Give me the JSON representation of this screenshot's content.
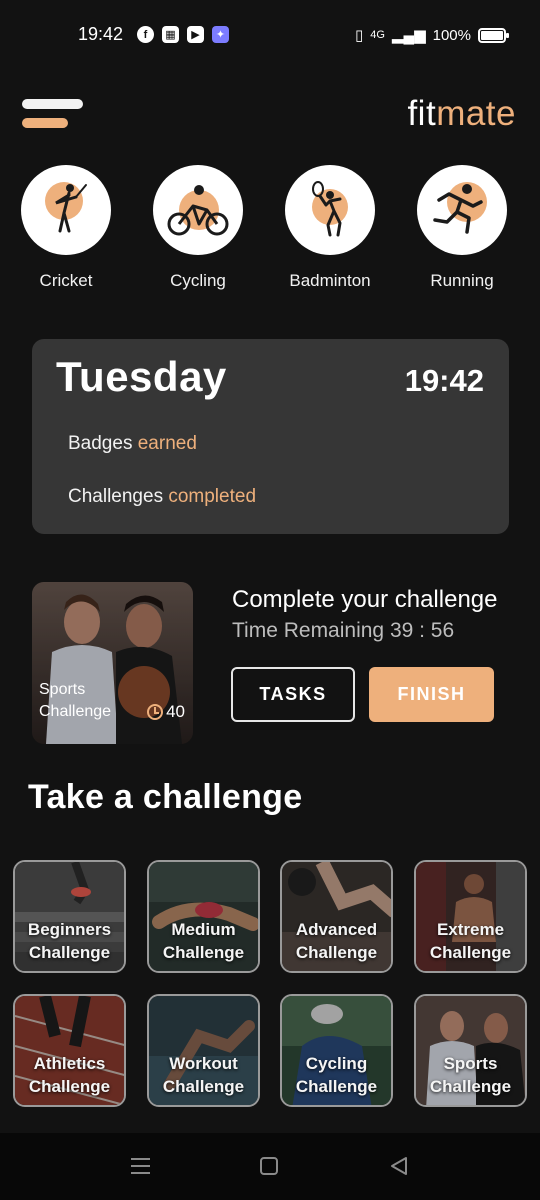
{
  "status_bar": {
    "time": "19:42",
    "app_icons": [
      "facebook-icon",
      "calendar-icon",
      "youtube-icon",
      "messenger-icon"
    ],
    "network": "4G",
    "battery": "100%"
  },
  "header": {
    "brand_prefix": "fit",
    "brand_suffix": "mate"
  },
  "sports": [
    {
      "label": "Cricket",
      "icon": "golf-swing-icon"
    },
    {
      "label": "Cycling",
      "icon": "cyclist-icon"
    },
    {
      "label": "Badminton",
      "icon": "badminton-player-icon"
    },
    {
      "label": "Running",
      "icon": "runner-icon"
    }
  ],
  "day_card": {
    "day": "Tuesday",
    "time": "19:42",
    "badges_prefix": "Badges ",
    "badges_highlight": "earned",
    "challenges_prefix": "Challenges ",
    "challenges_highlight": "completed"
  },
  "current_challenge": {
    "photo_caption_line1": "Sports",
    "photo_caption_line2": "Challenge",
    "timer_value": "40",
    "title": "Complete your challenge",
    "remaining": "Time Remaining 39 : 56",
    "tasks_label": "TASKS",
    "finish_label": "FINISH"
  },
  "take_challenge": {
    "title": "Take a challenge",
    "tiles": [
      {
        "line1": "Beginners",
        "line2": "Challenge"
      },
      {
        "line1": "Medium",
        "line2": "Challenge"
      },
      {
        "line1": "Advanced",
        "line2": "Challenge"
      },
      {
        "line1": "Extreme",
        "line2": "Challenge"
      },
      {
        "line1": "Athletics",
        "line2": "Challenge"
      },
      {
        "line1": "Workout",
        "line2": "Challenge"
      },
      {
        "line1": "Cycling",
        "line2": "Challenge"
      },
      {
        "line1": "Sports",
        "line2": "Challenge"
      }
    ]
  },
  "colors": {
    "background": "#121212",
    "accent": "#eeb07c",
    "card": "#363636"
  }
}
